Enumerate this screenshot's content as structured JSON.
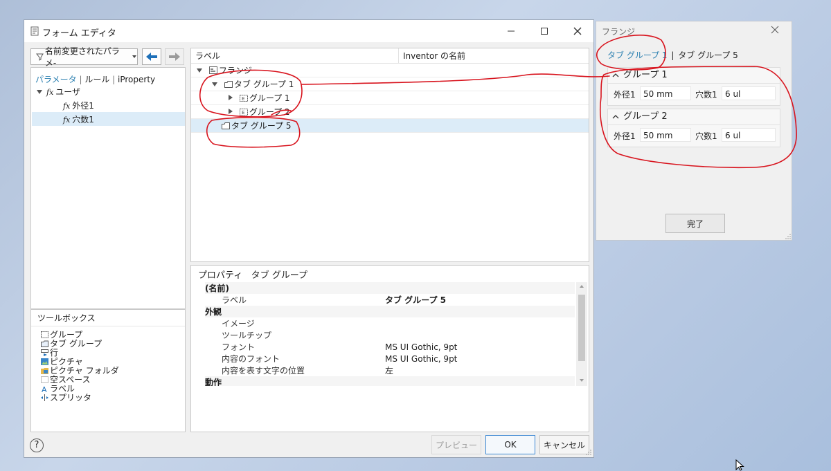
{
  "editor": {
    "title": "フォーム エディタ",
    "filter_button": "名前変更されたパラメ-",
    "param_tabs": [
      "パラメータ",
      "ルール",
      "iProperty"
    ],
    "param_tree": {
      "root": "ユーザ",
      "items": [
        "外径1",
        "穴数1"
      ]
    },
    "toolbox": {
      "title": "ツールボックス",
      "items": [
        "グループ",
        "タブ グループ",
        "行",
        "ピクチャ",
        "ピクチャ フォルダ",
        "空スペース",
        "ラベル",
        "スプリッタ"
      ]
    },
    "layout": {
      "columns": [
        "ラベル",
        "Inventor の名前"
      ],
      "rows": [
        "フランジ",
        "タブ グループ 1",
        "グループ 1",
        "グループ 2",
        "タブ グループ 5"
      ]
    },
    "properties": {
      "title": "プロパティ",
      "subtitle": "タブ グループ",
      "rows": [
        {
          "type": "cat",
          "name": "(名前)"
        },
        {
          "type": "prop",
          "name": "ラベル",
          "value": "タブ グループ 5"
        },
        {
          "type": "cat",
          "name": "外観"
        },
        {
          "type": "prop",
          "name": "イメージ",
          "value": ""
        },
        {
          "type": "prop",
          "name": "ツールチップ",
          "value": ""
        },
        {
          "type": "prop",
          "name": "フォント",
          "value": "MS UI Gothic, 9pt"
        },
        {
          "type": "prop",
          "name": "内容のフォント",
          "value": "MS UI Gothic, 9pt"
        },
        {
          "type": "prop",
          "name": "内容を表す文字の位置",
          "value": "左"
        },
        {
          "type": "cat",
          "name": "動作"
        }
      ]
    },
    "buttons": {
      "preview": "プレビュー",
      "ok": "OK",
      "cancel": "キャンセル"
    },
    "help": "?"
  },
  "flange": {
    "title": "フランジ",
    "tabs": [
      "タブ グループ 1",
      "タブ グループ 5"
    ],
    "tab_separator": "|",
    "groups": [
      {
        "title": "グループ 1",
        "fields": [
          {
            "label": "外径1",
            "value": "50 mm"
          },
          {
            "label": "穴数1",
            "value": "6 ul"
          }
        ]
      },
      {
        "title": "グループ 2",
        "fields": [
          {
            "label": "外径1",
            "value": "50 mm"
          },
          {
            "label": "穴数1",
            "value": "6 ul"
          }
        ]
      }
    ],
    "done_button": "完了"
  },
  "colors": {
    "accent": "#2a7fb0",
    "selection": "#dcecf8",
    "annotation": "#d8141e"
  }
}
